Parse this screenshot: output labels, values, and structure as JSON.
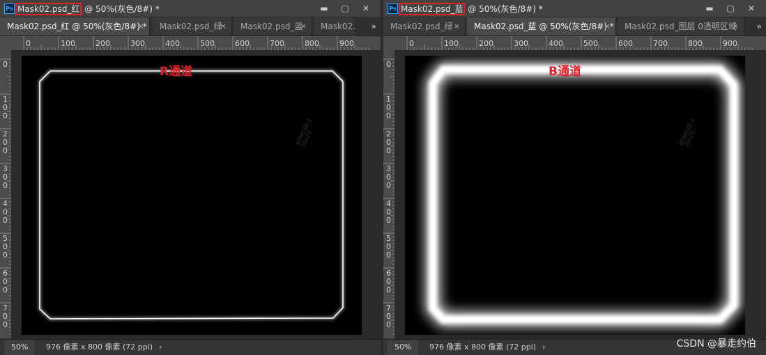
{
  "left": {
    "title_highlighted": "Mask02.psd_红",
    "title_rest": " @ 50%(灰色/8#) *",
    "tabs": [
      {
        "label": "Mask02.psd_红 @ 50%(灰色/8#) *",
        "close": "×",
        "active": true
      },
      {
        "label": "Mask02.psd_绿",
        "close": "×",
        "active": false
      },
      {
        "label": "Mask02.psd_蓝",
        "close": "×",
        "active": false
      },
      {
        "label": "Mask02.",
        "close": "",
        "active": false
      }
    ],
    "tab_more": "»",
    "channel_label": "R通道",
    "watermark": [
      "ATMG3B-1",
      "20x20"
    ],
    "zoom": "50%",
    "doc_info": "976 像素 x 800 像素 (72 ppi)",
    "status_arrow": "›"
  },
  "right": {
    "title_highlighted": "Mask02.psd_蓝",
    "title_rest": " @ 50%(灰色/8#) *",
    "tabs": [
      {
        "label": "Mask02.psd_绿",
        "close": "×",
        "active": false
      },
      {
        "label": "Mask02.psd_蓝 @ 50%(灰色/8#) *",
        "close": "×",
        "active": true
      },
      {
        "label": "Mask02.psd_图层 0透明区域",
        "close": "×",
        "active": false
      }
    ],
    "tab_more": "»",
    "channel_label": "B通道",
    "watermark": [
      "ATMG3B-1",
      "20x20"
    ],
    "zoom": "50%",
    "doc_info": "976 像素 x 800 像素 (72 ppi)",
    "status_arrow": "›"
  },
  "window_buttons": {
    "minimize": "▬",
    "maximize": "▢",
    "close": "✕"
  },
  "ruler": {
    "h_labels": [
      "0",
      "100",
      "200",
      "300",
      "400",
      "500",
      "600",
      "700",
      "800",
      "900"
    ],
    "v_labels": [
      "0",
      "100",
      "200",
      "300",
      "400",
      "500",
      "600",
      "700"
    ]
  },
  "credit": "CSDN @暴走约伯",
  "colors": {
    "highlight": "#e0202a",
    "canvas": "#000000",
    "panel": "#3a3a3a",
    "ruler": "#4b4b4b"
  }
}
